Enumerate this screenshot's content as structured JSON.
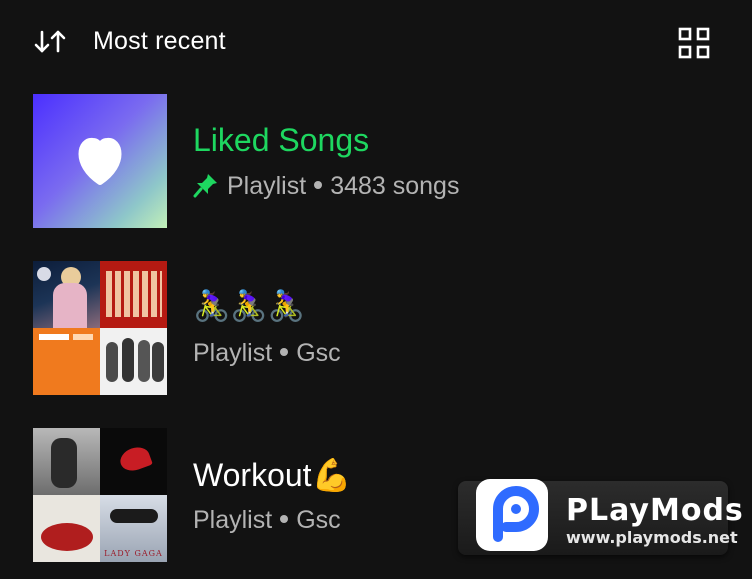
{
  "header": {
    "sort_label": "Most recent",
    "sort_icon": "sort-arrows-icon",
    "view_icon": "grid-view-icon"
  },
  "library": [
    {
      "title": "Liked Songs",
      "title_color": "#1ed760",
      "pinned": true,
      "type": "Playlist",
      "detail": "3483 songs",
      "art": "heart-icon"
    },
    {
      "title": "🚴‍♀️🚴‍♀️🚴‍♀️",
      "title_color": "#ffffff",
      "pinned": false,
      "type": "Playlist",
      "detail": "Gsc",
      "art": "album-mosaic"
    },
    {
      "title": "Workout💪",
      "title_color": "#ffffff",
      "pinned": false,
      "type": "Playlist",
      "detail": "Gsc",
      "art": "album-mosaic",
      "art_text": "LADY GAGA"
    }
  ],
  "watermark": {
    "brand": "PLayMods",
    "url": "www.playmods.net"
  },
  "colors": {
    "background": "#121212",
    "accent": "#1ed760",
    "subtext": "#b3b3b3"
  }
}
